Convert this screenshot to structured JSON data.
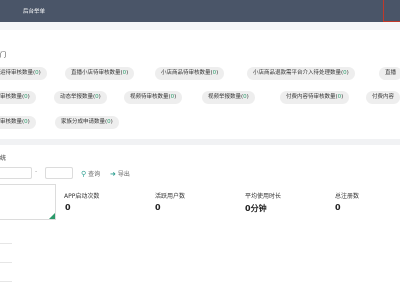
{
  "topbar": {
    "title": "后台举单"
  },
  "sections": {
    "audit_label": "门",
    "stats_label": "统"
  },
  "chips_row1": [
    {
      "label": "运待审核数量(",
      "count": "0",
      "suffix": ")"
    },
    {
      "label": "直播小店待审核数量(",
      "count": "0",
      "suffix": ")"
    },
    {
      "label": "小店商品待审核数量(",
      "count": "0",
      "suffix": ")"
    },
    {
      "label": "小店商品退款需平台介入待处理数量(",
      "count": "0",
      "suffix": ")"
    },
    {
      "label": "直播",
      "count": "",
      "suffix": ""
    }
  ],
  "chips_row2": [
    {
      "label": "审核数量(",
      "count": "0",
      "suffix": ")"
    },
    {
      "label": "动态举报数量(",
      "count": "0",
      "suffix": ")"
    },
    {
      "label": "视频待审核数量(",
      "count": "0",
      "suffix": ")"
    },
    {
      "label": "视频举报数量(",
      "count": "0",
      "suffix": ")"
    },
    {
      "label": "付费内容待审核数量(",
      "count": "0",
      "suffix": ")"
    },
    {
      "label": "付费内容",
      "count": "",
      "suffix": ""
    }
  ],
  "chips_row3": [
    {
      "label": "审核数量(",
      "count": "0",
      "suffix": ")"
    },
    {
      "label": "家族分成申请数量(",
      "count": "0",
      "suffix": ")"
    }
  ],
  "filter": {
    "date_separator": "-",
    "search_label": "查询",
    "export_label": "导出"
  },
  "stats": [
    {
      "label": "APP启动次数",
      "value": "0"
    },
    {
      "label": "活跃用户数",
      "value": "0"
    },
    {
      "label": "平均使用时长",
      "value": "0分钟"
    },
    {
      "label": "总注册数",
      "value": "0"
    }
  ]
}
